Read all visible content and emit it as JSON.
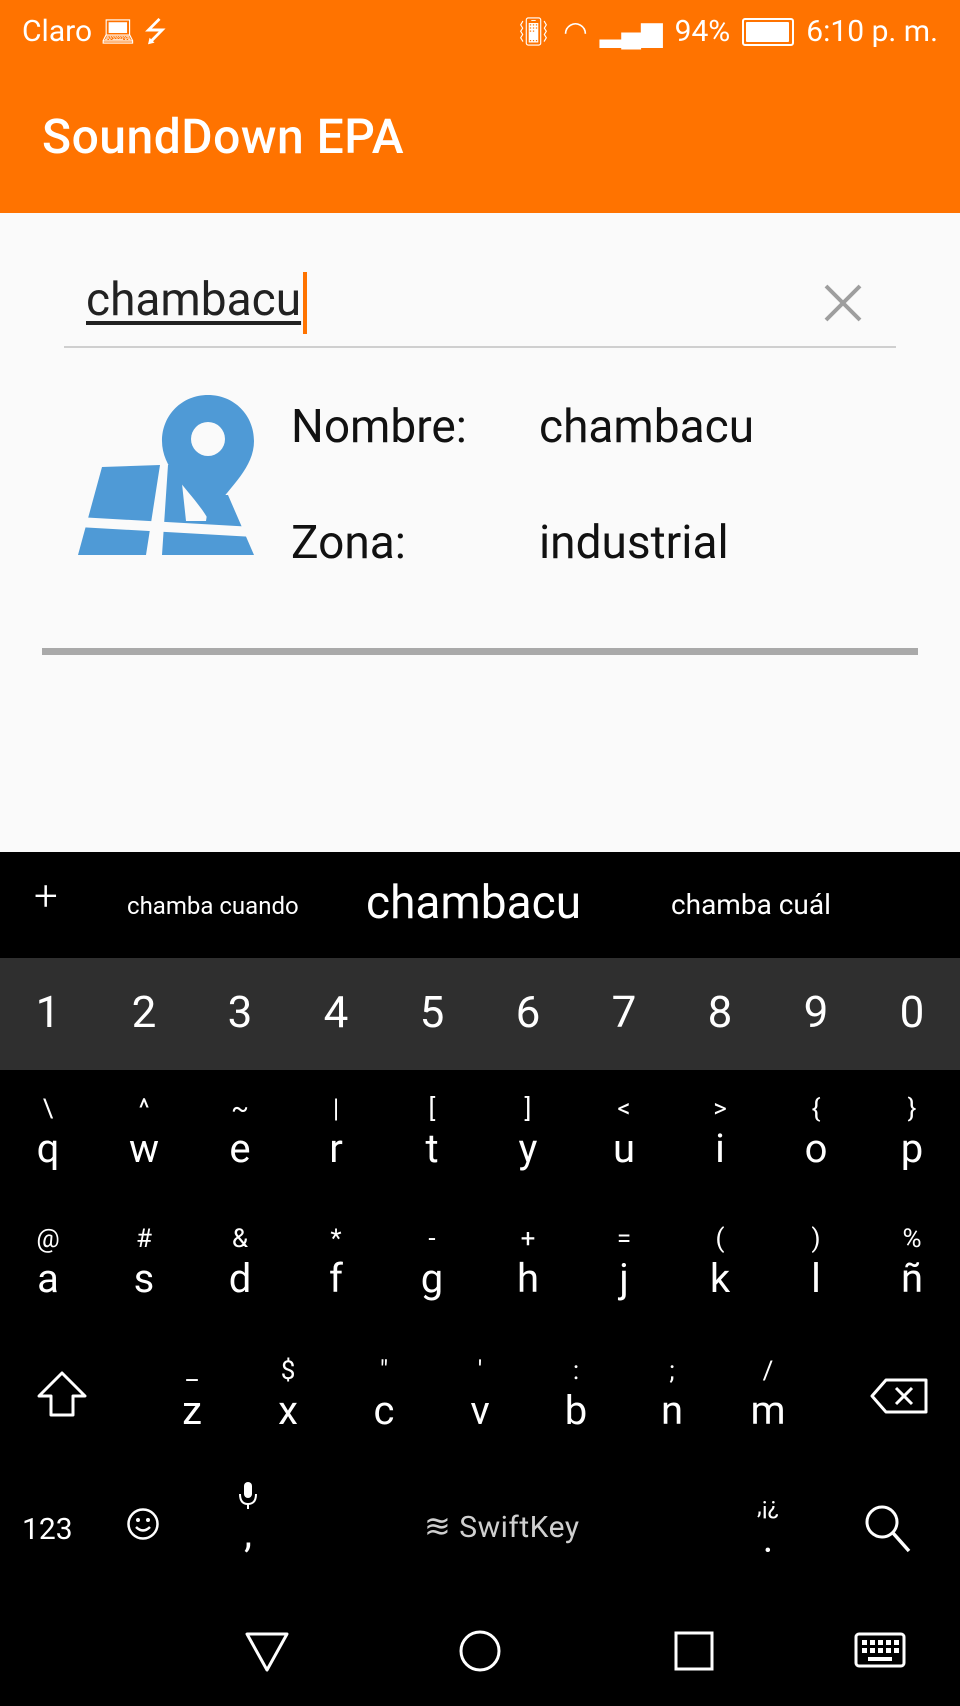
{
  "status_bar": {
    "carrier": "Claro",
    "battery": "94%",
    "time": "6:10 p. m."
  },
  "app": {
    "title": "SoundDown EPA"
  },
  "search": {
    "value": "chambacu"
  },
  "result": {
    "name_label": "Nombre:",
    "name_value": "chambacu",
    "zone_label": "Zona:",
    "zone_value": "industrial"
  },
  "keyboard": {
    "suggestions": [
      "chamba cuando",
      "chambacu",
      "chamba cuál"
    ],
    "numbers": [
      "1",
      "2",
      "3",
      "4",
      "5",
      "6",
      "7",
      "8",
      "9",
      "0"
    ],
    "row1": [
      {
        "sec": "\\",
        "pri": "q"
      },
      {
        "sec": "^",
        "pri": "w"
      },
      {
        "sec": "~",
        "pri": "e"
      },
      {
        "sec": "|",
        "pri": "r"
      },
      {
        "sec": "[",
        "pri": "t"
      },
      {
        "sec": "]",
        "pri": "y"
      },
      {
        "sec": "<",
        "pri": "u"
      },
      {
        "sec": ">",
        "pri": "i"
      },
      {
        "sec": "{",
        "pri": "o"
      },
      {
        "sec": "}",
        "pri": "p"
      }
    ],
    "row2": [
      {
        "sec": "@",
        "pri": "a"
      },
      {
        "sec": "#",
        "pri": "s"
      },
      {
        "sec": "&",
        "pri": "d"
      },
      {
        "sec": "*",
        "pri": "f"
      },
      {
        "sec": "-",
        "pri": "g"
      },
      {
        "sec": "+",
        "pri": "h"
      },
      {
        "sec": "=",
        "pri": "j"
      },
      {
        "sec": "(",
        "pri": "k"
      },
      {
        "sec": ")",
        "pri": "l"
      },
      {
        "sec": "%",
        "pri": "ñ"
      }
    ],
    "row3": [
      {
        "sec": "_",
        "pri": "z"
      },
      {
        "sec": "$",
        "pri": "x"
      },
      {
        "sec": "\"",
        "pri": "c"
      },
      {
        "sec": "'",
        "pri": "v"
      },
      {
        "sec": ":",
        "pri": "b"
      },
      {
        "sec": ";",
        "pri": "n"
      },
      {
        "sec": "/",
        "pri": "m"
      }
    ],
    "key_123": "123",
    "brand": "SwiftKey",
    "comma": ",",
    "punct_sec": ",¡¿",
    "punct_pri": "."
  }
}
